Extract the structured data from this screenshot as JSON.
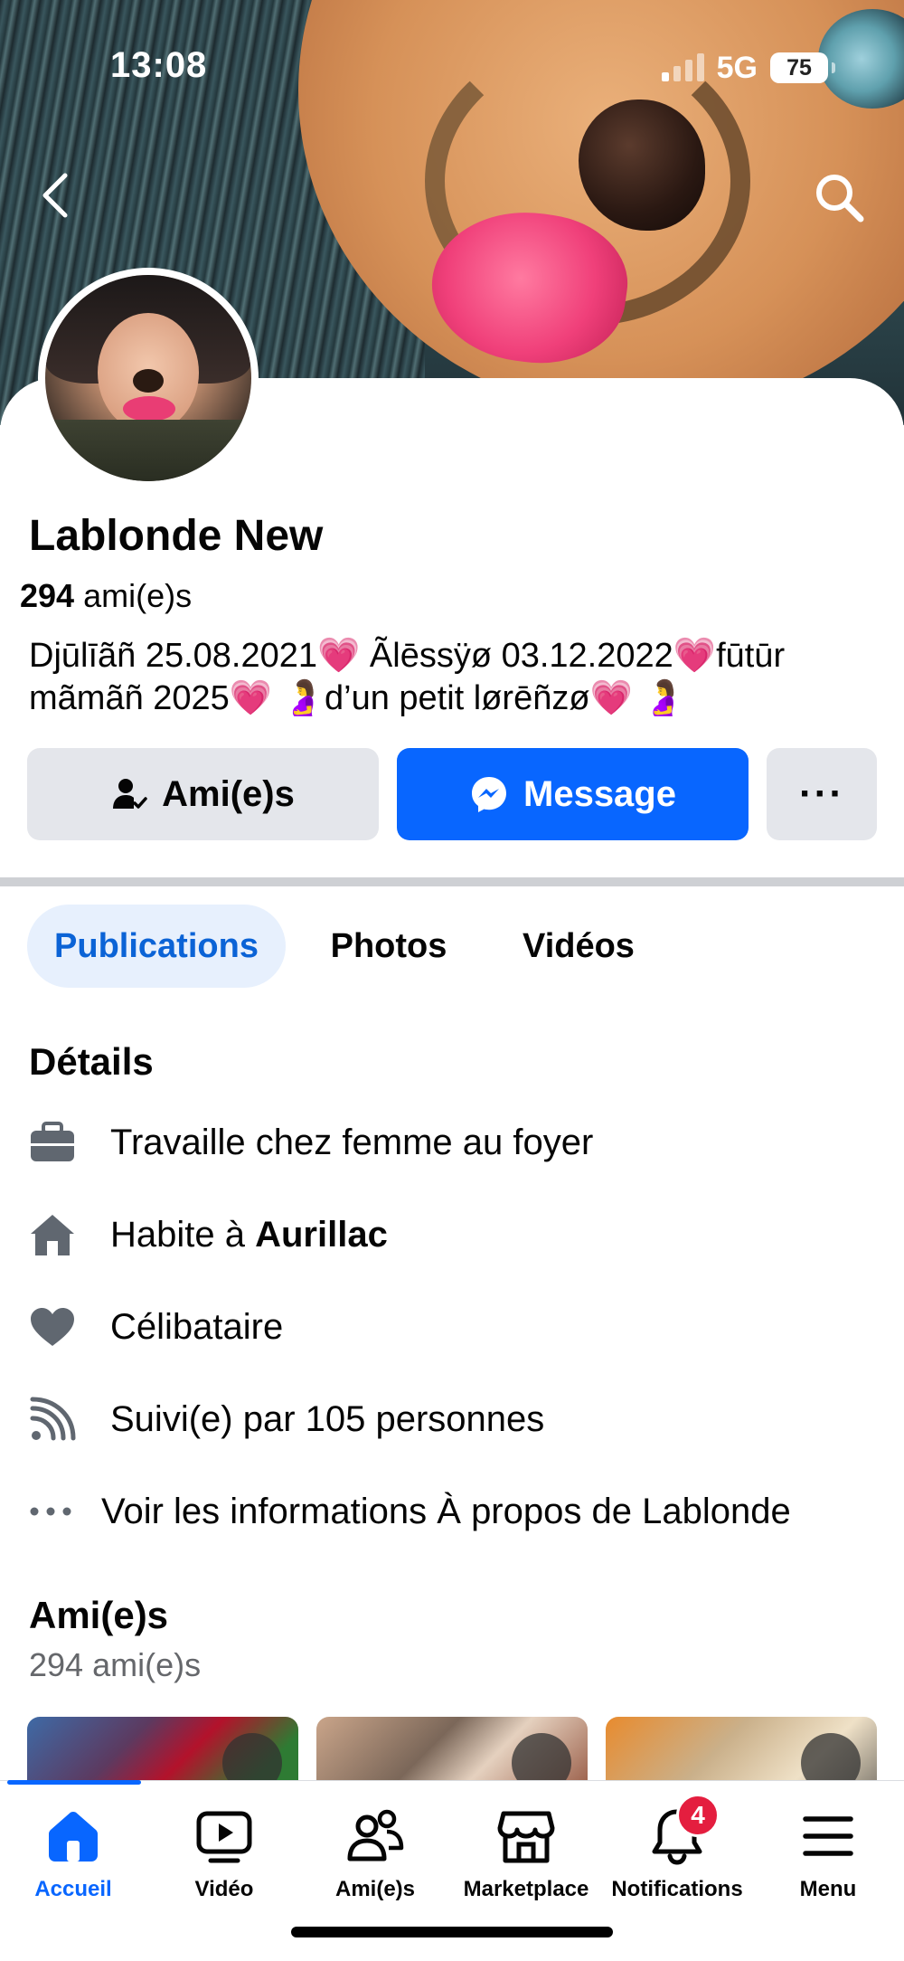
{
  "status_bar": {
    "time": "13:08",
    "network": "5G",
    "battery": "75"
  },
  "profile": {
    "name": "Lablonde New",
    "friends_count": "294",
    "friends_label": "ami(e)s",
    "bio_line1": "Djūlīãñ 25.08.2021💗 Ãlēssÿø 03.12.2022💗fūtūr",
    "bio_line2": "mãmãñ 2025💗 🤰d’un petit lørēñzø💗 🤰"
  },
  "actions": {
    "friends_label": "Ami(e)s",
    "message_label": "Message",
    "more_label": "···"
  },
  "tabs": [
    "Publications",
    "Photos",
    "Vidéos"
  ],
  "details": {
    "title": "Détails",
    "work": "Travaille chez femme au foyer",
    "lives_prefix": "Habite à ",
    "lives_city": "Aurillac",
    "relationship": "Célibataire",
    "followers": "Suivi(e) par 105 personnes",
    "about": "Voir les informations À propos de Lablonde"
  },
  "friends_section": {
    "title": "Ami(e)s",
    "count": "294 ami(e)s"
  },
  "bottom_nav": {
    "items": [
      "Accueil",
      "Vidéo",
      "Ami(e)s",
      "Marketplace",
      "Notifications",
      "Menu"
    ],
    "notifications_badge": "4",
    "active": "Accueil"
  },
  "colors": {
    "accent": "#0866ff",
    "badge": "#e41e3f",
    "tab_active_bg": "#e7f0fd"
  }
}
